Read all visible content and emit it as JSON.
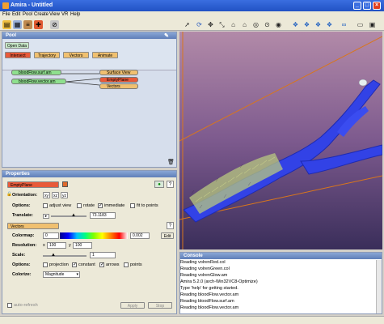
{
  "window": {
    "title": "Amira - Untitled"
  },
  "menu": [
    "File",
    "Edit",
    "Pool",
    "Create",
    "View",
    "VR",
    "Help"
  ],
  "pool": {
    "header": "Pool",
    "buttons": {
      "open_data": "Open Data",
      "intersect": "Intersect",
      "trajectory": "Trajectory",
      "vectors": "Vectors",
      "animate": "Animate"
    },
    "nodes": {
      "data1": "bloodFlow.surf.am",
      "data2": "bloodFlow.vector.am",
      "mod1": "Surface View",
      "mod2": "EmptyPlane",
      "mod3": "Vectors"
    }
  },
  "properties": {
    "header": "Properties",
    "module_name": "EmptyPlane",
    "orientation": {
      "label": "Orientation:",
      "xy": "xy",
      "xz": "xz",
      "yz": "yz"
    },
    "options1": {
      "label": "Options:",
      "adjust_view": "adjust view",
      "rotate": "rotate",
      "immediate": "immediate",
      "fit_to_points": "fit to points"
    },
    "translate": {
      "label": "Translate:",
      "value": "73.1183"
    },
    "vectors_module": "Vectors",
    "colormap": {
      "label": "Colormap:",
      "min": "0",
      "max": "0.002",
      "edit": "Edit"
    },
    "resolution": {
      "label": "Resolution:",
      "x_label": "x",
      "x": "100",
      "y_label": "y",
      "y": "100"
    },
    "scale": {
      "label": "Scale:",
      "value": "1"
    },
    "options2": {
      "label": "Options:",
      "projection": "projection",
      "constant": "constant",
      "arrows": "arrows",
      "points": "points"
    },
    "colorize": {
      "label": "Colorize:",
      "value": "Magnitude"
    },
    "auto_refresh": "auto-refresh",
    "apply": "Apply",
    "stop": "Stop"
  },
  "console": {
    "header": "Console",
    "lines": [
      "Reading volrenRed.col",
      "Reading volrenGreen.col",
      "Reading volrenGlow.am",
      "Amira 5.2.0 (arch-Win32VC8-Optimize)",
      "Type 'help' for getting started.",
      "Reading bloodFlow.vector.am",
      "Reading bloodFlow.surf.am",
      "Reading bloodFlow.vector.am"
    ]
  },
  "colors": {
    "accent": "#e06a2c",
    "vessel": "#2f3fe8",
    "viewer_bg": "#7a5a8f"
  }
}
